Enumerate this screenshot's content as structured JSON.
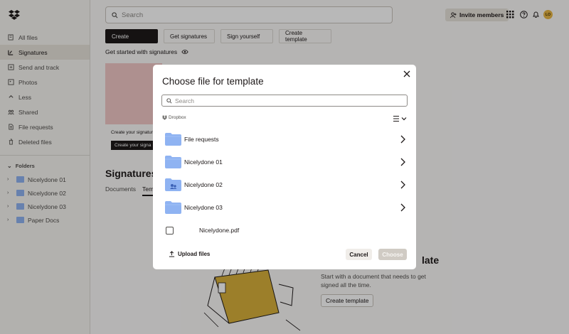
{
  "sidebar": {
    "items": [
      {
        "label": "All files",
        "icon": "files-icon"
      },
      {
        "label": "Signatures",
        "icon": "signature-icon",
        "active": true
      },
      {
        "label": "Send and track",
        "icon": "send-icon"
      },
      {
        "label": "Photos",
        "icon": "photo-icon"
      },
      {
        "label": "Less",
        "icon": "chevron-up-icon"
      },
      {
        "label": "Shared",
        "icon": "shared-icon"
      },
      {
        "label": "File requests",
        "icon": "file-request-icon"
      },
      {
        "label": "Deleted files",
        "icon": "trash-icon"
      }
    ],
    "folders_heading": "Folders",
    "folders": [
      "Nicelydone 01",
      "Nicelydone 02",
      "Nicelydone 03",
      "Paper Docs"
    ]
  },
  "header": {
    "search_placeholder": "Search",
    "invite_label": "Invite members",
    "avatar_initials": "LO"
  },
  "main": {
    "tabs": [
      "Create",
      "Get signatures",
      "Sign yourself",
      "Create template"
    ],
    "get_started": "Get started with signatures",
    "card_text": "Create your signature",
    "card_button": "Create your signa",
    "section_title": "Signatures",
    "sub_tabs": [
      "Documents",
      "Temp"
    ],
    "empty_title": "late",
    "empty_desc": "Start with a document that needs to get signed all the time.",
    "create_template_button": "Create template"
  },
  "modal": {
    "title": "Choose file for template",
    "search_placeholder": "Search",
    "breadcrumb": "Dropbox",
    "files": [
      {
        "name": "File requests",
        "type": "folder"
      },
      {
        "name": "Nicelydone 01",
        "type": "folder"
      },
      {
        "name": "Nicelydone 02",
        "type": "shared-folder"
      },
      {
        "name": "Nicelydone 03",
        "type": "folder"
      },
      {
        "name": "Nicelydone.pdf",
        "type": "file"
      }
    ],
    "upload_label": "Upload files",
    "cancel_label": "Cancel",
    "choose_label": "Choose"
  },
  "colors": {
    "accent_dark": "#1e1919",
    "folder_blue": "#8fb3f2",
    "avatar_yellow": "#e8b645",
    "card_pink": "#f2c8c6"
  }
}
